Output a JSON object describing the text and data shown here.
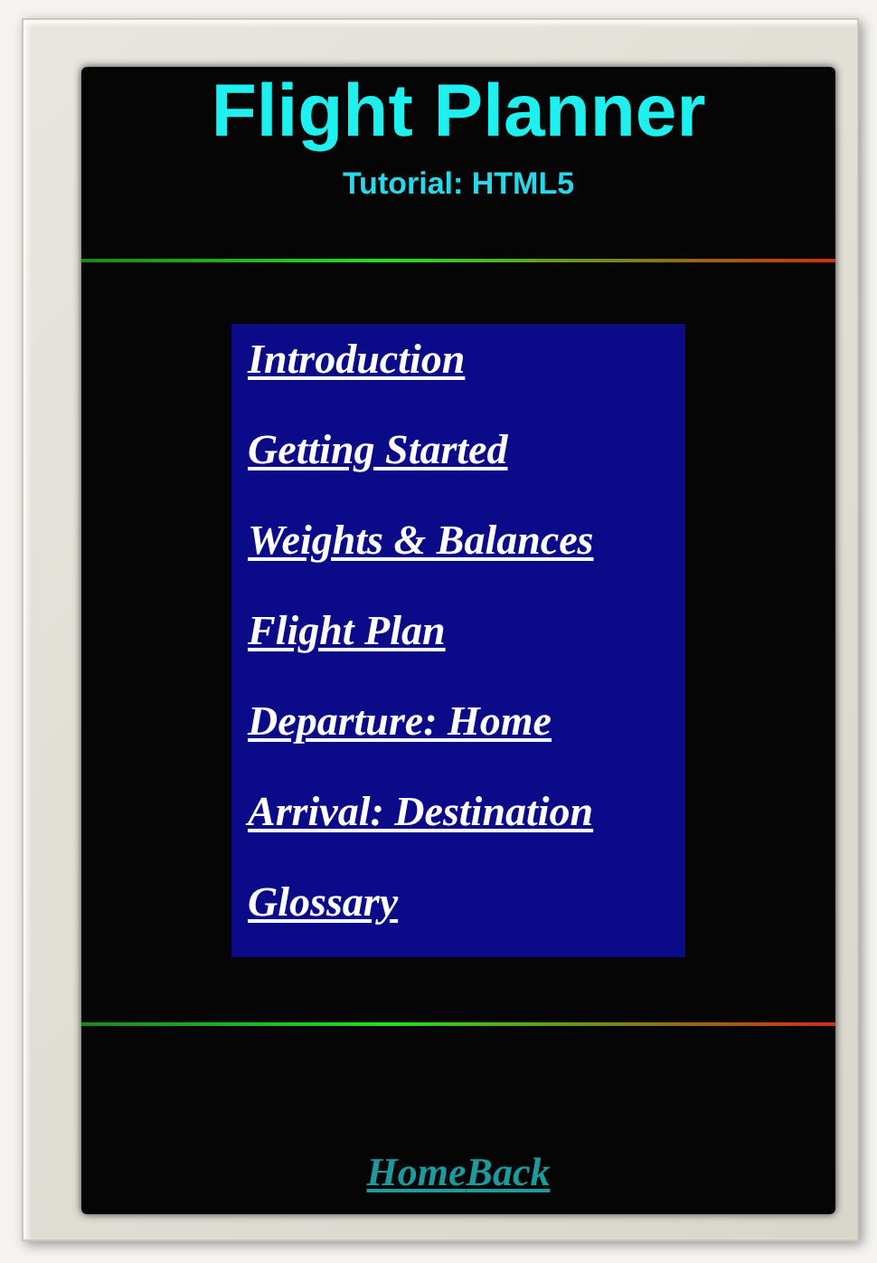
{
  "header": {
    "title": "Flight Planner",
    "subtitle": "Tutorial: HTML5"
  },
  "menu": [
    {
      "label": "Introduction"
    },
    {
      "label": "Getting Started"
    },
    {
      "label": "Weights & Balances"
    },
    {
      "label": "Flight Plan"
    },
    {
      "label": "Departure: Home"
    },
    {
      "label": "Arrival: Destination"
    },
    {
      "label": "Glossary"
    }
  ],
  "footer": {
    "links": [
      {
        "label": "Home"
      },
      {
        "label": "Back"
      }
    ]
  }
}
